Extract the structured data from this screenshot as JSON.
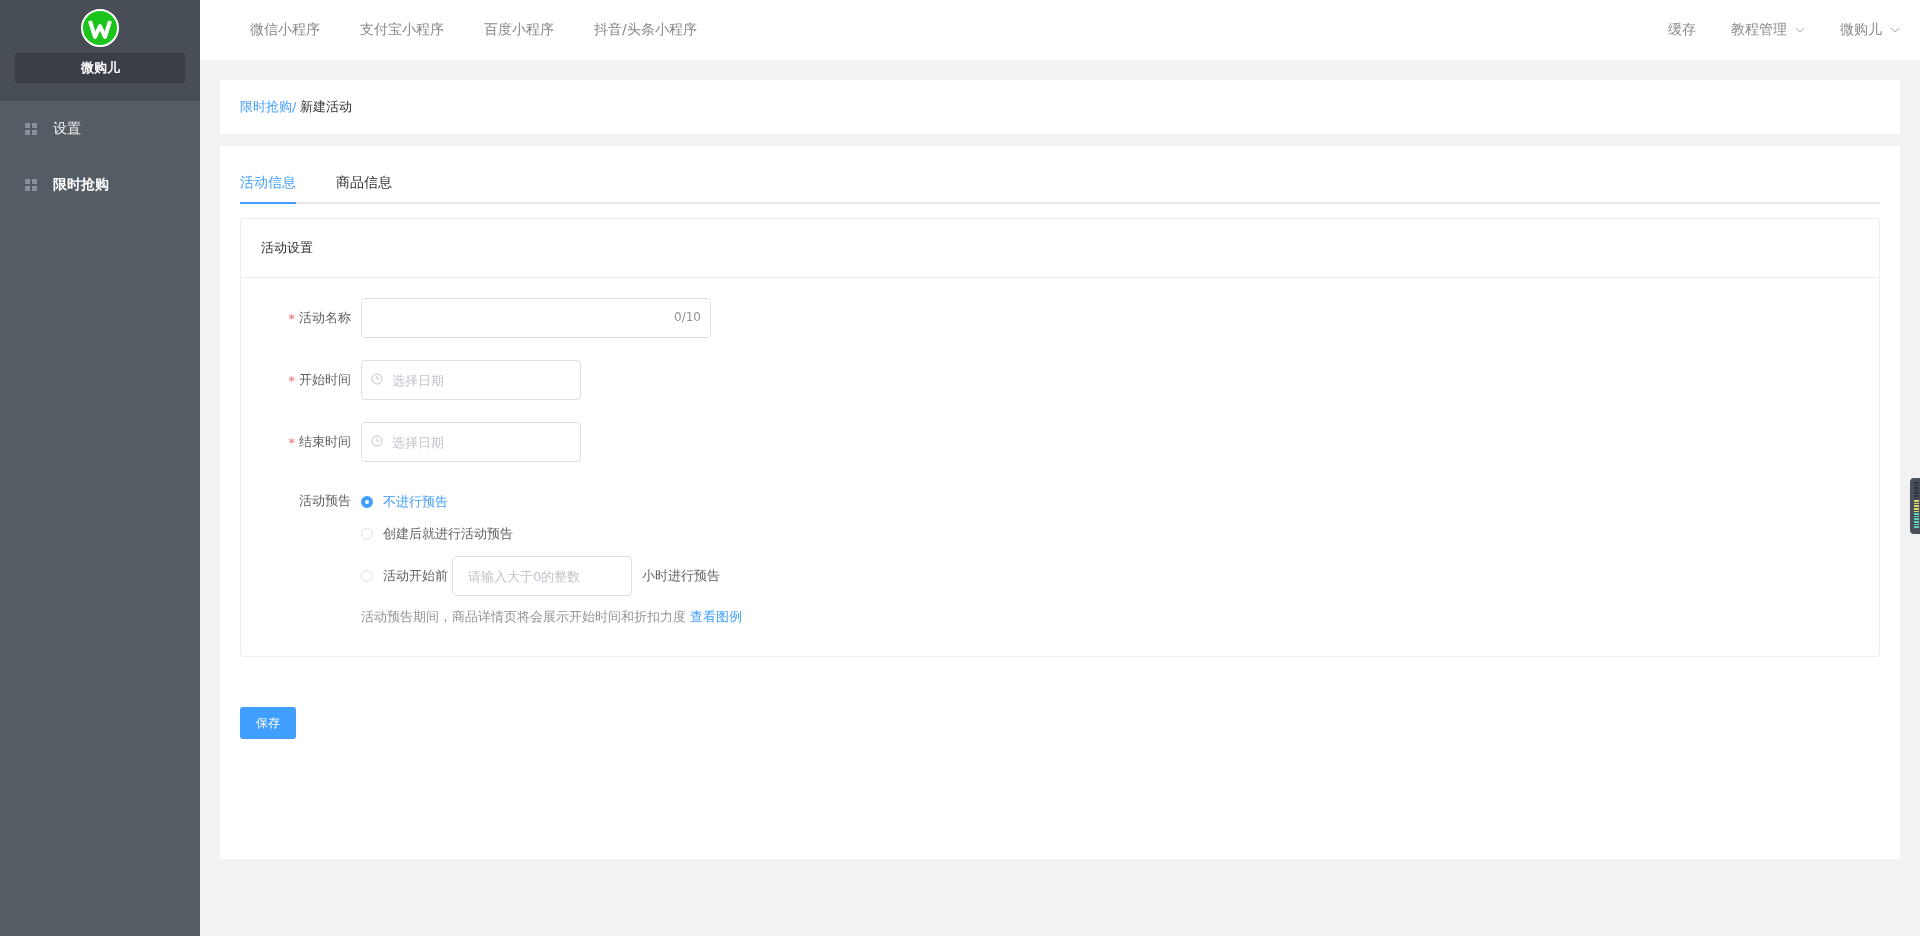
{
  "sidebar": {
    "brand": "微购儿",
    "items": [
      {
        "label": "设置",
        "selected": false
      },
      {
        "label": "限时抢购",
        "selected": true
      }
    ]
  },
  "top_nav": {
    "links": [
      {
        "label": "微信小程序"
      },
      {
        "label": "支付宝小程序"
      },
      {
        "label": "百度小程序"
      },
      {
        "label": "抖音/头条小程序"
      }
    ],
    "right": [
      {
        "label": "缓存",
        "dropdown": false
      },
      {
        "label": "教程管理",
        "dropdown": true
      },
      {
        "label": "微购儿",
        "dropdown": true
      }
    ]
  },
  "breadcrumb": [
    "限时抢购/",
    "新建活动"
  ],
  "tabs": [
    {
      "label": "活动信息",
      "selected": true
    },
    {
      "label": "商品信息",
      "selected": false
    }
  ],
  "section_title": "活动设置",
  "fields": [
    {
      "kind": "text",
      "label": "活动名称",
      "required_mark": "*",
      "counter": "0/10"
    },
    {
      "kind": "date",
      "label": "开始时间",
      "required_mark": "*",
      "placeholder": "选择日期"
    },
    {
      "kind": "date",
      "label": "结束时间",
      "required_mark": "*",
      "placeholder": "选择日期"
    }
  ],
  "preview": {
    "label": "活动预告",
    "options": [
      {
        "label": "不进行预告",
        "selected": true
      },
      {
        "label": "创建后就进行活动预告",
        "selected": false
      },
      {
        "label": "活动开始前",
        "selected": false,
        "placeholder": "请输入大于0的整数",
        "suffix": "小时进行预告"
      }
    ],
    "hint": "活动预告期间，商品详情页将会展示开始时间和折扣力度",
    "hint_link": "查看图例"
  },
  "save_button": "保存"
}
